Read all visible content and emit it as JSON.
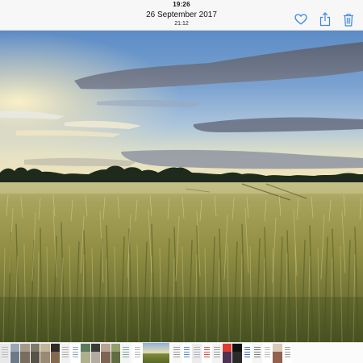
{
  "status_bar": {
    "time": "19:26"
  },
  "nav": {
    "date": "26 September 2017",
    "time": "21:12",
    "actions": [
      {
        "icon": "heart-icon",
        "name": "favorite-button"
      },
      {
        "icon": "share-icon",
        "name": "share-button"
      },
      {
        "icon": "trash-icon",
        "name": "delete-button"
      }
    ]
  },
  "photo": {
    "subject": "barley-field-at-sunset"
  },
  "colors": {
    "accent": "#3d86e8",
    "sky_top": "#5f8fc8",
    "horizon": "#f1e3b0",
    "field": "#8c8a3e"
  },
  "thumbnails": [
    {
      "kind": "doc",
      "bg": "#e8e8e8",
      "fg": "#b9b9b9"
    },
    {
      "kind": "photo",
      "bg": "#9aa8b6",
      "fg": "#5d6a77"
    },
    {
      "kind": "photo",
      "bg": "#a49b8a",
      "fg": "#6a5f50"
    },
    {
      "kind": "photo",
      "bg": "#7f7a6a",
      "fg": "#4a463c"
    },
    {
      "kind": "photo",
      "bg": "#c1b59b",
      "fg": "#8b7e65"
    },
    {
      "kind": "photo",
      "bg": "#2e2a28",
      "fg": "#a07f5b"
    },
    {
      "kind": "doc",
      "bg": "#f2f2f2",
      "fg": "#aaaaaa"
    },
    {
      "kind": "doc",
      "bg": "#ffffff",
      "fg": "#8ea6c4"
    },
    {
      "kind": "photo",
      "bg": "#5c7b5e",
      "fg": "#c9c09c"
    },
    {
      "kind": "photo",
      "bg": "#3c3a36",
      "fg": "#d8d1c4"
    },
    {
      "kind": "photo",
      "bg": "#b8a596",
      "fg": "#6e4f3c"
    },
    {
      "kind": "photo",
      "bg": "#92a06b",
      "fg": "#4f5c33"
    },
    {
      "kind": "doc",
      "bg": "#f4f4f4",
      "fg": "#7cae9e"
    },
    {
      "kind": "doc",
      "bg": "#ffffff",
      "fg": "#b5b5b5"
    },
    {
      "kind": "current",
      "bg": "#8fb0d6",
      "fg": "#7b8a3a"
    },
    {
      "kind": "doc",
      "bg": "#f7f7f7",
      "fg": "#9a9a9a"
    },
    {
      "kind": "doc",
      "bg": "#ffffff",
      "fg": "#5a86c0"
    },
    {
      "kind": "doc",
      "bg": "#ececec",
      "fg": "#b0b0b0"
    },
    {
      "kind": "doc",
      "bg": "#ffffff",
      "fg": "#d24a3a"
    },
    {
      "kind": "doc",
      "bg": "#f3f3f3",
      "fg": "#9e9e9e"
    },
    {
      "kind": "photo",
      "bg": "#e03c31",
      "fg": "#1c2f5c"
    },
    {
      "kind": "photo",
      "bg": "#111111",
      "fg": "#333333"
    },
    {
      "kind": "doc",
      "bg": "#ffffff",
      "fg": "#3f6fb0"
    },
    {
      "kind": "doc",
      "bg": "#f5f5f5",
      "fg": "#7a7a7a"
    },
    {
      "kind": "doc",
      "bg": "#ffffff",
      "fg": "#bbbbbb"
    },
    {
      "kind": "photo",
      "bg": "#d9cbb8",
      "fg": "#7a3d2e"
    },
    {
      "kind": "doc",
      "bg": "#ffffff",
      "fg": "#9a9a9a"
    }
  ]
}
